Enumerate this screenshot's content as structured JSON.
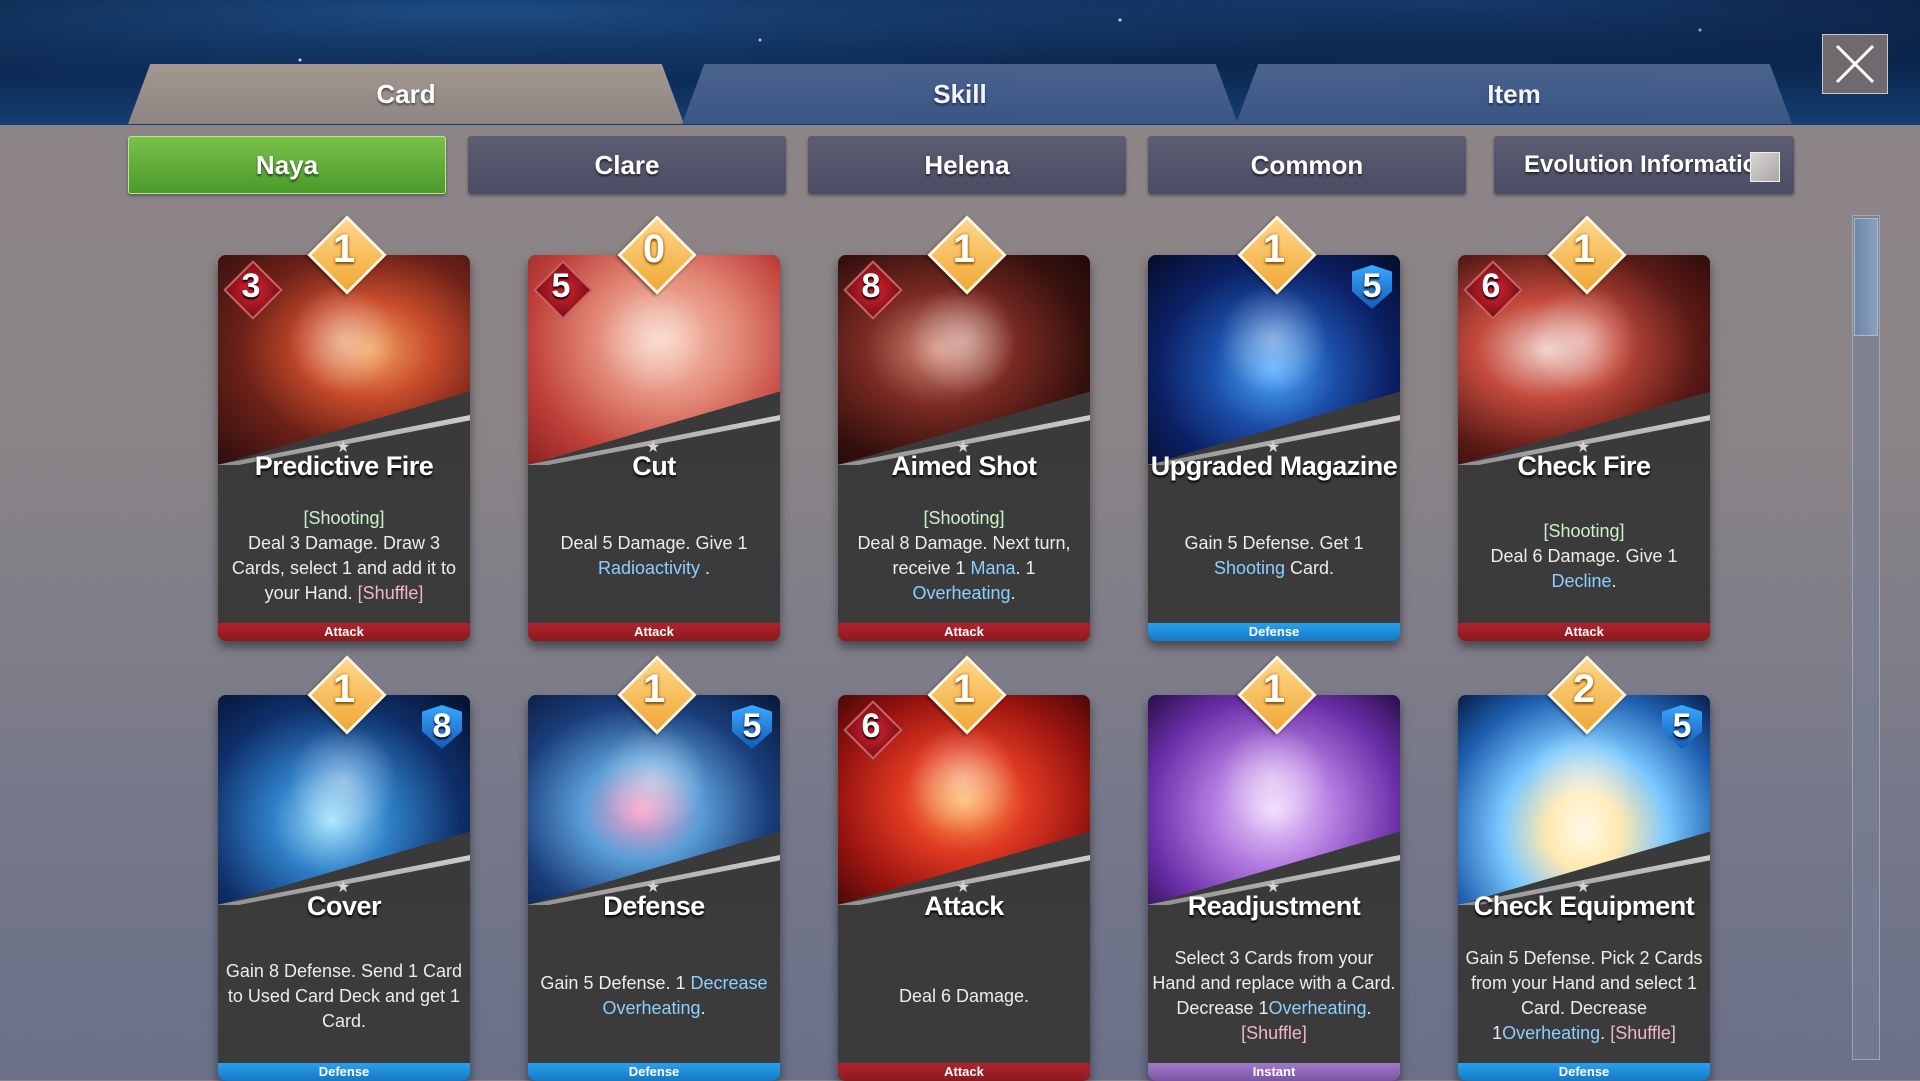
{
  "top_tabs": [
    {
      "label": "Card",
      "active": true
    },
    {
      "label": "Skill",
      "active": false
    },
    {
      "label": "Item",
      "active": false
    }
  ],
  "sub_tabs": [
    {
      "label": "Naya",
      "active": true
    },
    {
      "label": "Clare",
      "active": false
    },
    {
      "label": "Helena",
      "active": false
    },
    {
      "label": "Common",
      "active": false
    },
    {
      "label": "Evolution Information",
      "active": false
    }
  ],
  "close_icon": "close-icon",
  "colors": {
    "attack": "#b1222b",
    "defense": "#27a1ee",
    "instant": "#a07ac8",
    "active_subtab": "#5fae3a",
    "cost_badge": "#f0a836",
    "keyword": "#c9f3c7",
    "highlight": "#8cd0ff"
  },
  "cards": [
    {
      "name": "Predictive Fire",
      "cost": "1",
      "stat": "3",
      "stat_kind": "damage",
      "type": "Attack",
      "desc": [
        [
          "kw",
          "[Shooting]"
        ],
        [
          "t",
          "Deal 3 Damage. Draw 3 Cards, select 1 and add it to your Hand. "
        ],
        [
          "sh",
          "[Shuffle]"
        ]
      ]
    },
    {
      "name": "Cut",
      "cost": "0",
      "stat": "5",
      "stat_kind": "damage",
      "type": "Attack",
      "desc": [
        [
          "t",
          "Deal 5 Damage. Give 1 "
        ],
        [
          "hl",
          "Radioactivity"
        ],
        [
          "t",
          " ."
        ]
      ]
    },
    {
      "name": "Aimed Shot",
      "cost": "1",
      "stat": "8",
      "stat_kind": "damage",
      "type": "Attack",
      "desc": [
        [
          "kw",
          "[Shooting]"
        ],
        [
          "t",
          "Deal 8 Damage. Next turn, receive 1 "
        ],
        [
          "hl",
          "Mana"
        ],
        [
          "t",
          ". 1 "
        ],
        [
          "hl",
          "Overheating"
        ],
        [
          "t",
          "."
        ]
      ]
    },
    {
      "name": "Upgraded Magazine",
      "cost": "1",
      "stat": "5",
      "stat_kind": "defense",
      "type": "Defense",
      "desc": [
        [
          "t",
          "Gain 5 Defense. Get 1 "
        ],
        [
          "hl",
          "Shooting"
        ],
        [
          "t",
          " Card."
        ]
      ]
    },
    {
      "name": "Check Fire",
      "cost": "1",
      "stat": "6",
      "stat_kind": "damage",
      "type": "Attack",
      "desc": [
        [
          "kw",
          "[Shooting]"
        ],
        [
          "t",
          "Deal 6 Damage. Give 1 "
        ],
        [
          "hl",
          "Decline"
        ],
        [
          "t",
          "."
        ]
      ]
    },
    {
      "name": "Cover",
      "cost": "1",
      "stat": "8",
      "stat_kind": "defense",
      "type": "Defense",
      "desc": [
        [
          "t",
          "Gain 8 Defense. Send 1 Card to Used Card Deck and get 1 Card."
        ]
      ]
    },
    {
      "name": "Defense",
      "cost": "1",
      "stat": "5",
      "stat_kind": "defense",
      "type": "Defense",
      "desc": [
        [
          "t",
          "Gain 5 Defense. 1 "
        ],
        [
          "hl",
          "Decrease Overheating"
        ],
        [
          "t",
          "."
        ]
      ]
    },
    {
      "name": "Attack",
      "cost": "1",
      "stat": "6",
      "stat_kind": "damage",
      "type": "Attack",
      "desc": [
        [
          "t",
          "Deal 6 Damage."
        ]
      ]
    },
    {
      "name": "Readjustment",
      "cost": "1",
      "stat": "",
      "stat_kind": "none",
      "type": "Instant",
      "desc": [
        [
          "t",
          "Select 3 Cards from your Hand and replace with a Card. Decrease 1"
        ],
        [
          "hl",
          "Overheating"
        ],
        [
          "t",
          ". "
        ],
        [
          "sh",
          "[Shuffle]"
        ]
      ]
    },
    {
      "name": "Check Equipment",
      "cost": "2",
      "stat": "5",
      "stat_kind": "defense",
      "type": "Defense",
      "desc": [
        [
          "t",
          "Gain 5 Defense. Pick 2 Cards from your Hand and select 1 Card. Decrease 1"
        ],
        [
          "hl",
          "Overheating"
        ],
        [
          "t",
          ". "
        ],
        [
          "sh",
          "[Shuffle]"
        ]
      ]
    }
  ]
}
